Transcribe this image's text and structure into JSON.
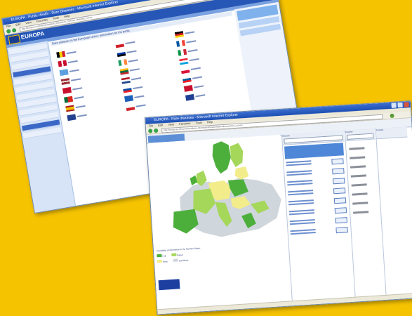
{
  "back_window": {
    "title": "EUROPA - Public Health - Rare Diseases - Microsoft Internet Explorer",
    "menu": [
      "File",
      "Edit",
      "View",
      "Favorites",
      "Tools",
      "Help"
    ],
    "address": "http://europa.eu.int/comm/health/ph_threats/non_com/rare_diseases_en.htm",
    "brand": "EUROPA",
    "heading": "Rare diseases in the European Union: Information for the public",
    "right_box_label": "Health & Consumer Protection"
  },
  "front_window": {
    "title": "EUROPA - Rare diseases - Microsoft Internet Explorer",
    "menu": [
      "File",
      "Edit",
      "View",
      "Favorites",
      "Tools",
      "Help"
    ],
    "address": "http://europa.eu.int/comm/health/ph_information/dissemination/diseases/rare_en.htm",
    "legend_title": "Availability of information in the Member States",
    "legend_items": [
      "Full",
      "Partial",
      "None",
      "Candidate"
    ],
    "column_headers": [
      "Disease",
      "Country",
      "Contact"
    ]
  },
  "colors": {
    "background": "#f6c300",
    "titlebar": "#1d4fb3",
    "eu_blue": "#2657b7",
    "map_dark_green": "#4caf3c",
    "map_light_green": "#a5d75a",
    "map_yellow": "#f2ec8a",
    "map_grey": "#cfd6dc"
  }
}
